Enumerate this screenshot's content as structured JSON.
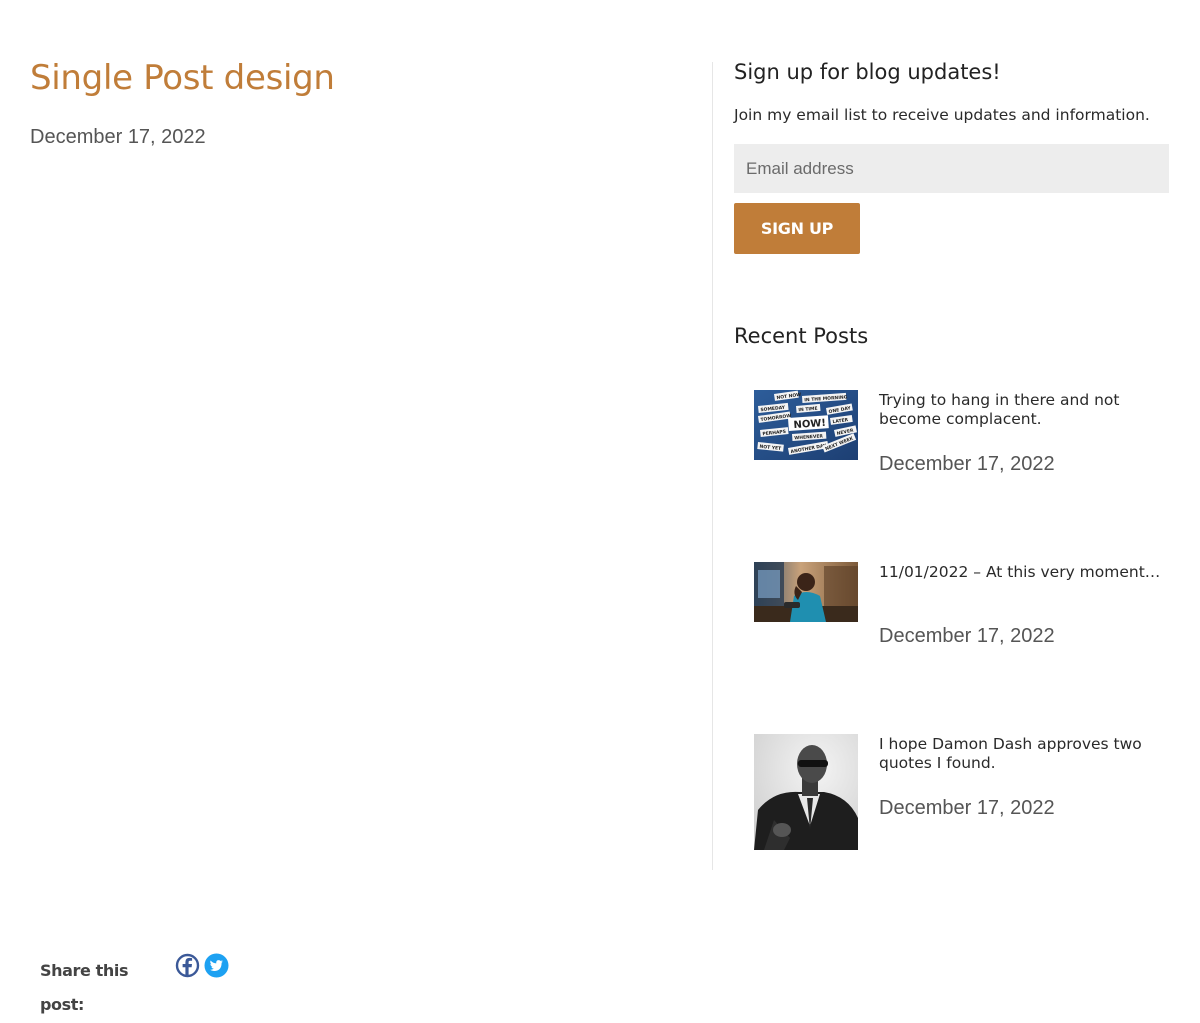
{
  "post": {
    "title": "Single Post design",
    "date": "December 17, 2022"
  },
  "sidebar": {
    "signup": {
      "title": "Sign up for blog updates!",
      "description": "Join my email list to receive updates and information.",
      "email_placeholder": "Email address",
      "button_label": "SIGN UP"
    },
    "recent": {
      "title": "Recent Posts",
      "items": [
        {
          "title": "Trying to hang in there and not become complacent.",
          "date": "December 17, 2022",
          "thumb_words": [
            "NOT NOW",
            "IN THE MORNING",
            "SOMEDAY",
            "IN TIME",
            "TOMORROW",
            "ONE DAY",
            "NOW!",
            "LATER",
            "PERHAPS",
            "WHENEVER",
            "NEVER",
            "NOT YET",
            "ANOTHER DAY",
            "NEXT WEEK"
          ]
        },
        {
          "title": "11/01/2022 – At this very moment…",
          "date": "December 17, 2022"
        },
        {
          "title": "I hope Damon Dash approves two quotes I found.",
          "date": "December 17, 2022"
        }
      ]
    }
  },
  "share": {
    "label": "Share this post:",
    "icons": [
      "facebook-icon",
      "twitter-icon"
    ],
    "colors": {
      "facebook": "#3b5998",
      "twitter": "#1da1f2"
    }
  },
  "colors": {
    "accent": "#c07d39",
    "text": "#2a2a2a",
    "muted": "#555555",
    "input_bg": "#ededed"
  }
}
